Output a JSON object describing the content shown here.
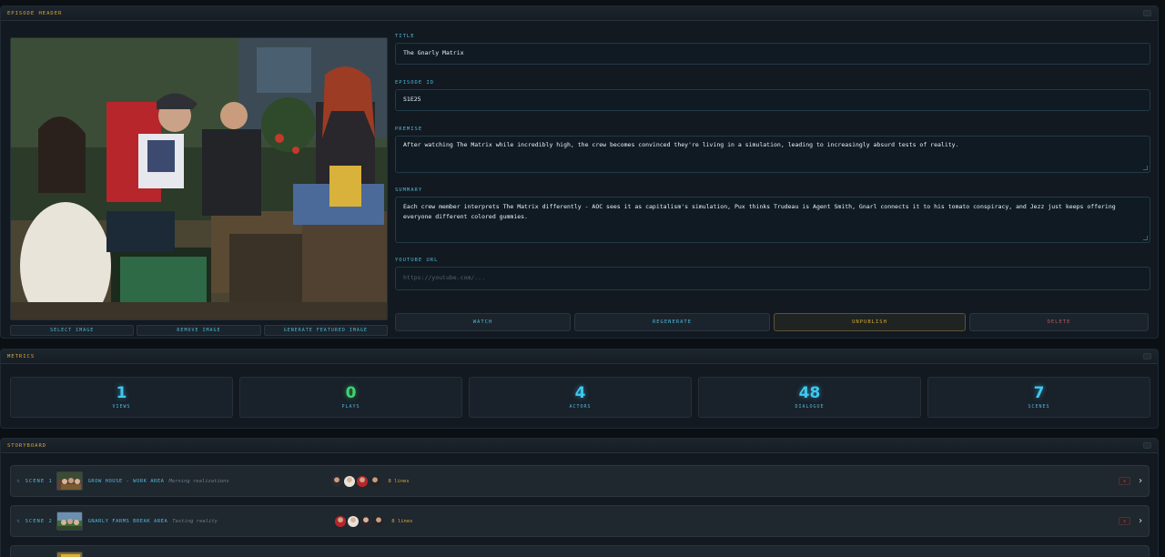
{
  "episode_header": {
    "title": "EPISODE HEADER",
    "image_buttons": [
      "SELECT IMAGE",
      "REMOVE IMAGE",
      "GENERATE FEATURED IMAGE"
    ],
    "fields": {
      "title": {
        "label": "TITLE",
        "value": "The Gnarly Matrix"
      },
      "episode_id": {
        "label": "EPISODE ID",
        "value": "S1E25"
      },
      "premise": {
        "label": "PREMISE",
        "value": "After watching The Matrix while incredibly high, the crew becomes convinced they're living in a simulation, leading to increasingly absurd tests of reality."
      },
      "summary": {
        "label": "SUMMARY",
        "value": "Each crew member interprets The Matrix differently - AOC sees it as capitalism's simulation, Pux thinks Trudeau is Agent Smith, Gnarl connects it to his tomato conspiracy, and Jezz just keeps offering everyone different colored gummies."
      },
      "youtube": {
        "label": "YOUTUBE URL",
        "placeholder": "https://youtube.com/..."
      }
    },
    "actions": {
      "watch": "WATCH",
      "regenerate": "REGENERATE",
      "unpublish": "UNPUBLISH",
      "delete": "DELETE"
    }
  },
  "metrics": {
    "title": "METRICS",
    "items": [
      {
        "value": "1",
        "label": "VIEWS",
        "color": "#3ec8f0"
      },
      {
        "value": "0",
        "label": "PLAYS",
        "color": "#3ed46e"
      },
      {
        "value": "4",
        "label": "ACTORS",
        "color": "#3ec8f0"
      },
      {
        "value": "48",
        "label": "DIALOGUE",
        "color": "#3ec8f0"
      },
      {
        "value": "7",
        "label": "SCENES",
        "color": "#3ec8f0"
      }
    ]
  },
  "storyboard": {
    "title": "STORYBOARD",
    "scenes": [
      {
        "number": "SCENE 1",
        "location": "GROW HOUSE - WORK AREA",
        "subtitle": "Morning realizations",
        "lines": "8 lines"
      },
      {
        "number": "SCENE 2",
        "location": "GNARLY FARMS BREAK AREA",
        "subtitle": "Testing reality",
        "lines": "8 lines"
      }
    ]
  },
  "icons": {
    "drag": "drag-handle-icon",
    "delete": "close-icon",
    "expand": "chevron-right-icon"
  },
  "colors": {
    "accent": "#4fb7d9",
    "gold": "#d8a83a",
    "danger": "#b05a5a",
    "success": "#3ed46e"
  }
}
